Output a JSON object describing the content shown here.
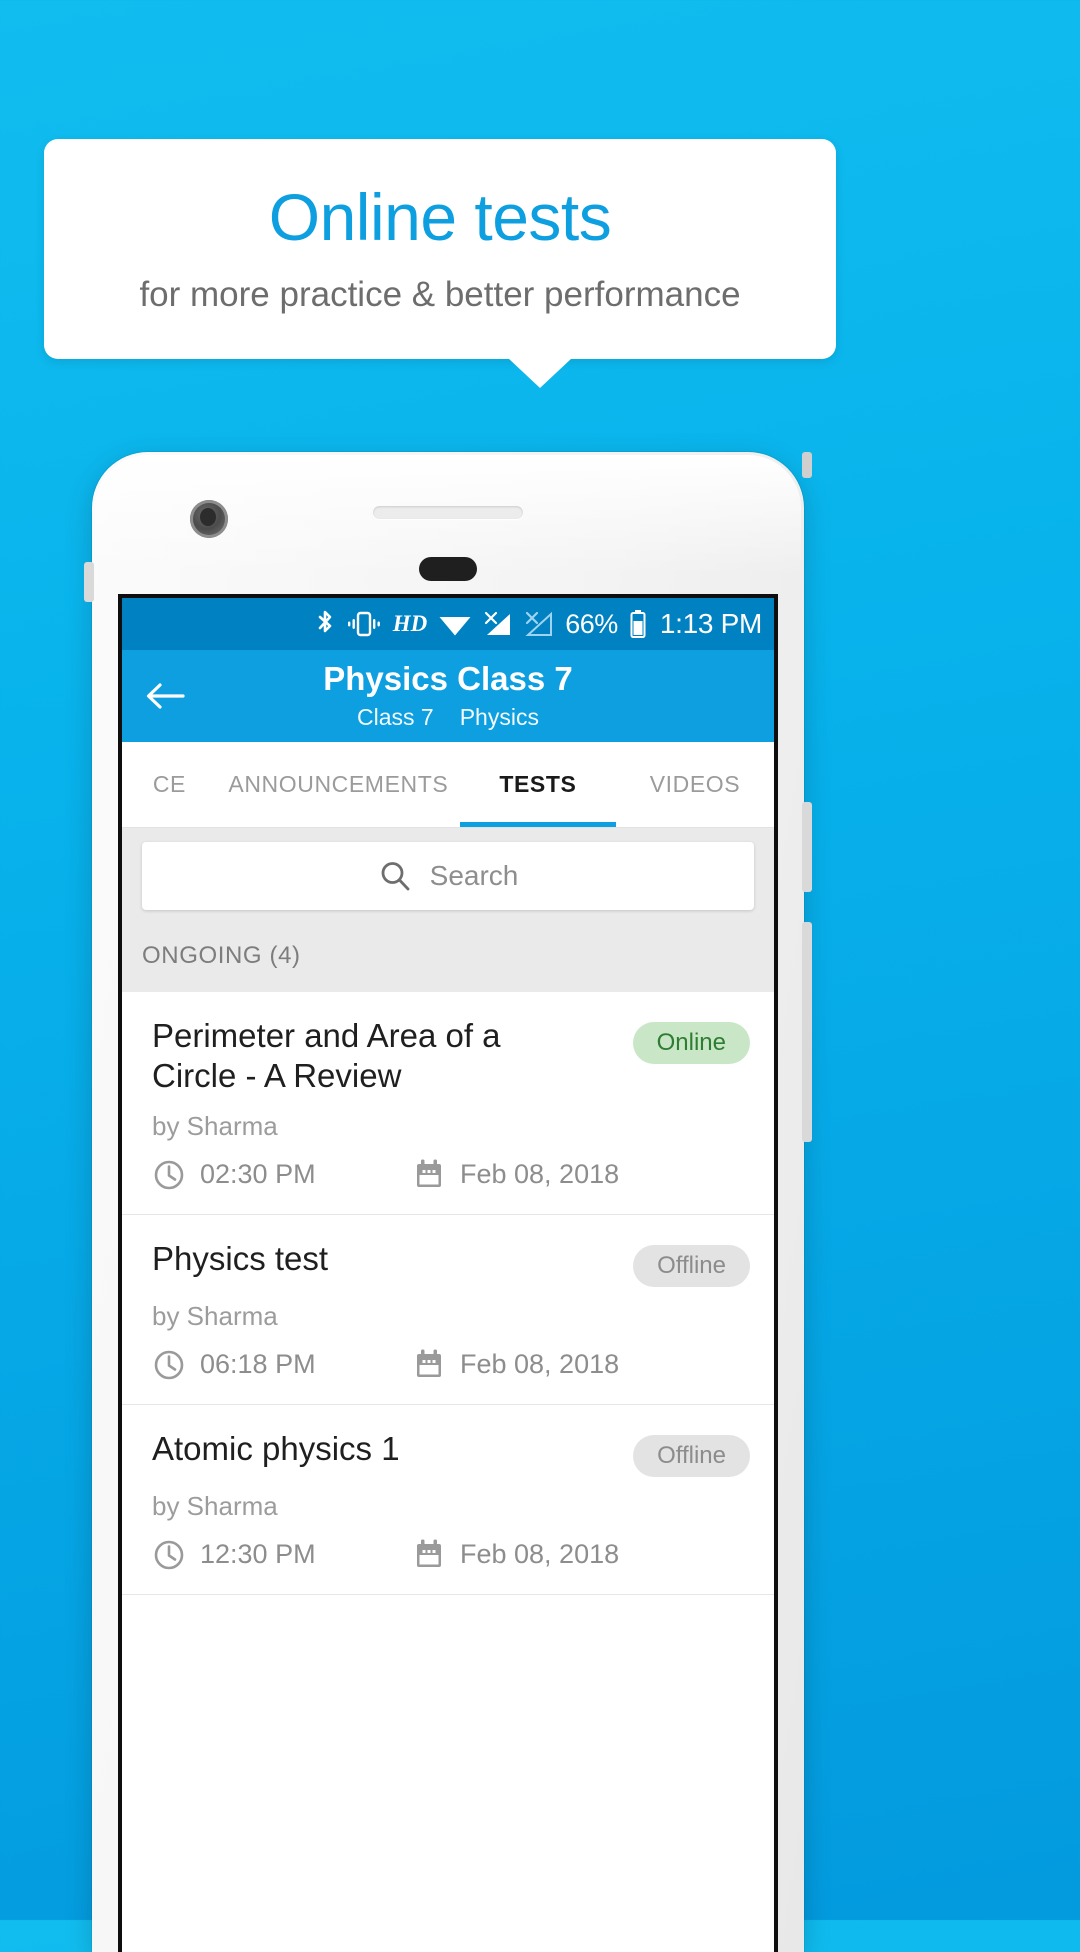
{
  "promo": {
    "title": "Online tests",
    "subtitle": "for more practice & better performance",
    "accent_color": "#0d9fe0",
    "background_color": "#08b3ec"
  },
  "statusbar": {
    "icons": [
      "bluetooth-icon",
      "vibrate-icon",
      "hd-icon",
      "wifi-icon",
      "signal-1-icon",
      "signal-2-icon"
    ],
    "hd_label": "HD",
    "battery_percent": "66%",
    "time": "1:13 PM"
  },
  "appbar": {
    "back_icon": "back-arrow-icon",
    "title": "Physics Class 7",
    "subtitle_class": "Class 7",
    "subtitle_subject": "Physics",
    "background_color": "#0d9fe0"
  },
  "tabs": {
    "items": [
      {
        "label": "CE",
        "active": false
      },
      {
        "label": "ANNOUNCEMENTS",
        "active": false
      },
      {
        "label": "TESTS",
        "active": true
      },
      {
        "label": "VIDEOS",
        "active": false
      }
    ]
  },
  "search": {
    "placeholder": "Search",
    "value": "",
    "icon": "search-icon"
  },
  "section": {
    "label": "ONGOING (4)"
  },
  "tests": [
    {
      "title": "Perimeter and Area of a Circle - A Review",
      "author": "by Sharma",
      "status": "Online",
      "status_type": "online",
      "time": "02:30 PM",
      "date": "Feb 08, 2018"
    },
    {
      "title": "Physics test",
      "author": "by Sharma",
      "status": "Offline",
      "status_type": "offline",
      "time": "06:18 PM",
      "date": "Feb 08, 2018"
    },
    {
      "title": "Atomic physics 1",
      "author": "by Sharma",
      "status": "Offline",
      "status_type": "offline",
      "time": "12:30 PM",
      "date": "Feb 08, 2018"
    }
  ]
}
